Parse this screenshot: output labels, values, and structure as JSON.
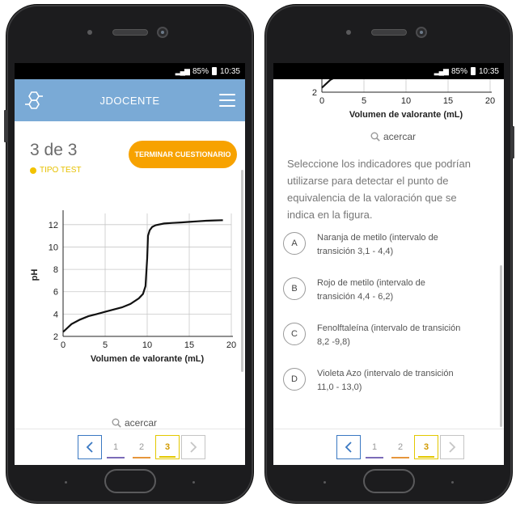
{
  "status": {
    "network": "4G",
    "battery": "85%",
    "time": "10:35"
  },
  "app": {
    "title": "JDOCENTE"
  },
  "quiz": {
    "counter": "3 de 3",
    "type": "TIPO TEST",
    "finish_label": "TERMINAR CUESTIONARIO",
    "zoom_label": "acercar",
    "question_lines": [
      "Seleccione los indicadores que podrían",
      "utilizarse para detectar el punto de",
      "equivalencia de la valoración que se",
      "indica en la figura."
    ],
    "options": [
      {
        "letter": "A",
        "line1": "Naranja de metilo (intervalo de",
        "line2": "transición 3,1 - 4,4)"
      },
      {
        "letter": "B",
        "line1": "Rojo de metilo (intervalo de",
        "line2": "transición 4,4 - 6,2)"
      },
      {
        "letter": "C",
        "line1": "Fenolftaleína (intervalo de transición",
        "line2": "8,2 -9,8)"
      },
      {
        "letter": "D",
        "line1": "Violeta Azo  (intervalo de transición",
        "line2": "11,0 - 13,0)"
      }
    ],
    "pages": [
      "1",
      "2",
      "3"
    ],
    "current_page": "3"
  },
  "chart_data": {
    "type": "line",
    "xlabel": "Volumen de valorante (mL)",
    "ylabel": "pH",
    "xlim": [
      0,
      20
    ],
    "ylim": [
      2,
      13
    ],
    "xticks": [
      "0",
      "5",
      "10",
      "15",
      "20"
    ],
    "yticks": [
      "2",
      "4",
      "6",
      "8",
      "10",
      "12"
    ],
    "grid": true,
    "x": [
      0,
      1,
      2,
      3,
      4,
      5,
      6,
      7,
      8,
      9,
      9.5,
      9.8,
      10,
      10.1,
      10.3,
      10.6,
      11,
      12,
      13,
      14,
      15,
      16,
      17,
      18,
      19
    ],
    "y": [
      2.4,
      3.1,
      3.5,
      3.8,
      4.0,
      4.2,
      4.4,
      4.6,
      4.9,
      5.4,
      5.8,
      6.5,
      9.0,
      11.0,
      11.5,
      11.8,
      11.95,
      12.1,
      12.15,
      12.2,
      12.25,
      12.3,
      12.35,
      12.38,
      12.4
    ]
  },
  "colors": {
    "appbar": "#7aaad6",
    "finish": "#f7a200",
    "type_dot": "#f2c200",
    "page_active": "#e3c800",
    "nav_active": "#3a78c2",
    "underline_1": "#7b6bb8",
    "underline_2": "#e6963c",
    "underline_3": "#e3c800"
  }
}
